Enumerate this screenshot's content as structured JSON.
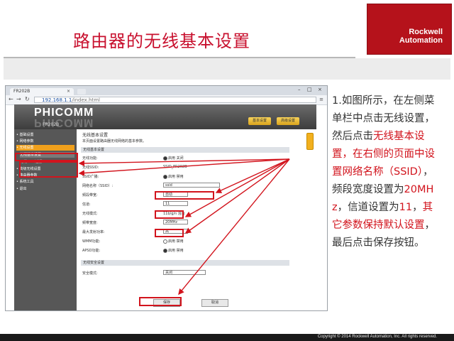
{
  "slide": {
    "title": "路由器的无线基本设置",
    "logo_line1": "Rockwell",
    "logo_line2": "Automation",
    "copyright": "Copyright © 2014 Rockwell Automation, Inc. All rights reserved."
  },
  "browser": {
    "tab_title": "FR202B",
    "tab_close": "×",
    "url": "192.168.1.1/index.html",
    "url_prefix": "192.168.1.1",
    "url_path": "/index.html"
  },
  "router": {
    "brand": "PHICOMM",
    "model": "FR202B",
    "buttons": [
      "基本设置",
      "高级设置"
    ],
    "sidebar": [
      "• 基础设置",
      "• 网络参数",
      "• 无线设置",
      "无线基本设置",
      "无线MAC过滤",
      "• 高级无线设置",
      "• 路由器参数",
      "• 系统工具",
      "• 退出"
    ],
    "page_title": "无线基本设置",
    "page_desc": "本页面设置路由器无线网络的基本参数。",
    "section1": "无线基本设置",
    "rows": [
      {
        "label": "无线功能:",
        "value": "启用  关闭"
      },
      {
        "label": "无线SSID:",
        "value": "SSID_FR202B"
      },
      {
        "label": "SSID广播:",
        "value": "启用  禁用"
      },
      {
        "label": "网络名称（SSID）:",
        "value": "ssid"
      },
      {
        "label": "频段带宽:",
        "value": "自动"
      },
      {
        "label": "信道:",
        "value": "11"
      },
      {
        "label": "无线模式:",
        "value": "11b/g/n 混合"
      },
      {
        "label": "频带宽度:",
        "value": "20MHz"
      },
      {
        "label": "最大发射功率:",
        "value": "高"
      },
      {
        "label": "WMM功能:",
        "value": "启用  禁用"
      },
      {
        "label": "APSD功能:",
        "value": "启用  禁用"
      }
    ],
    "section2": "无线安全设置",
    "security_label": "安全模式:",
    "security_value": "关闭",
    "save_button": "保存",
    "cancel_button": "取消"
  },
  "explanation": {
    "part1": "1.如图所示，在左侧菜单栏中点击无线设置，然后点击",
    "part2_highlight": "无线基本设置，在右侧的页面中设置网络名称（SSID）",
    "part3": "，频段宽度设置为",
    "part4_highlight": "20MHz",
    "part5": "，信道设置为",
    "part6_highlight": "11",
    "part7": "，",
    "part8_highlight": "其它参数保持默认设置",
    "part9": "，最后点击保存按钮。"
  },
  "colors": {
    "accent_red": "#d2141d",
    "logo_red": "#b5121b",
    "title_red": "#c8102e"
  }
}
